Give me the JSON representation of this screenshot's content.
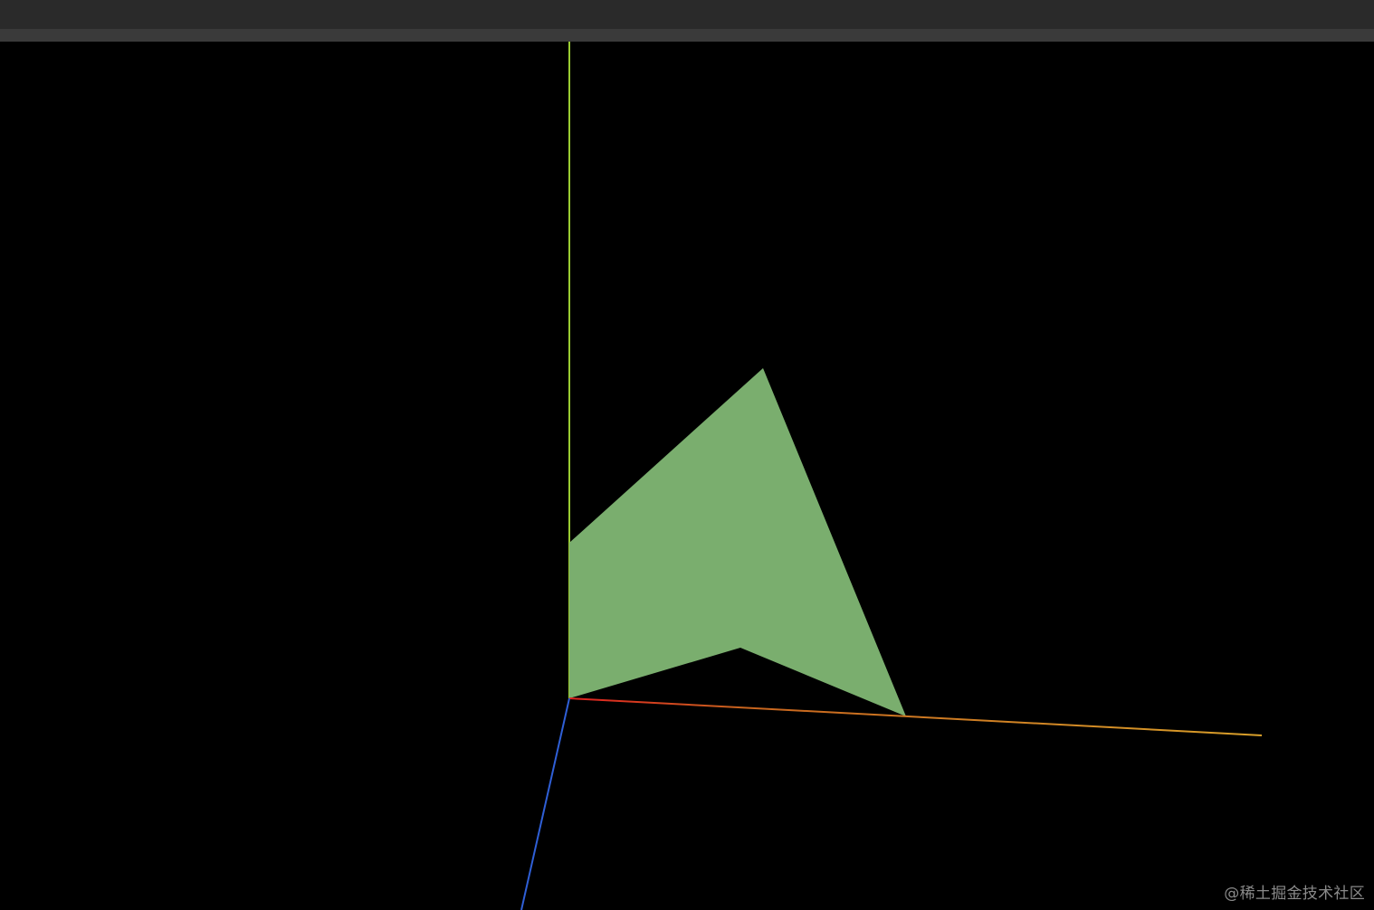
{
  "window": {
    "top_bar_color": "#2a2a2a",
    "toolbar_strip_color": "#3a3a3a"
  },
  "viewport": {
    "background_color": "#000000",
    "axes": {
      "x_axis_color": "#c8641e",
      "x_axis_tip_color": "#d9a02a",
      "y_axis_color": "#9acd32",
      "z_axis_color": "#2f5fd6"
    },
    "mesh": {
      "shape": "concave polygon",
      "fill_color": "#7aae6e"
    }
  },
  "watermark": {
    "text": "@稀土掘金技术社区"
  }
}
